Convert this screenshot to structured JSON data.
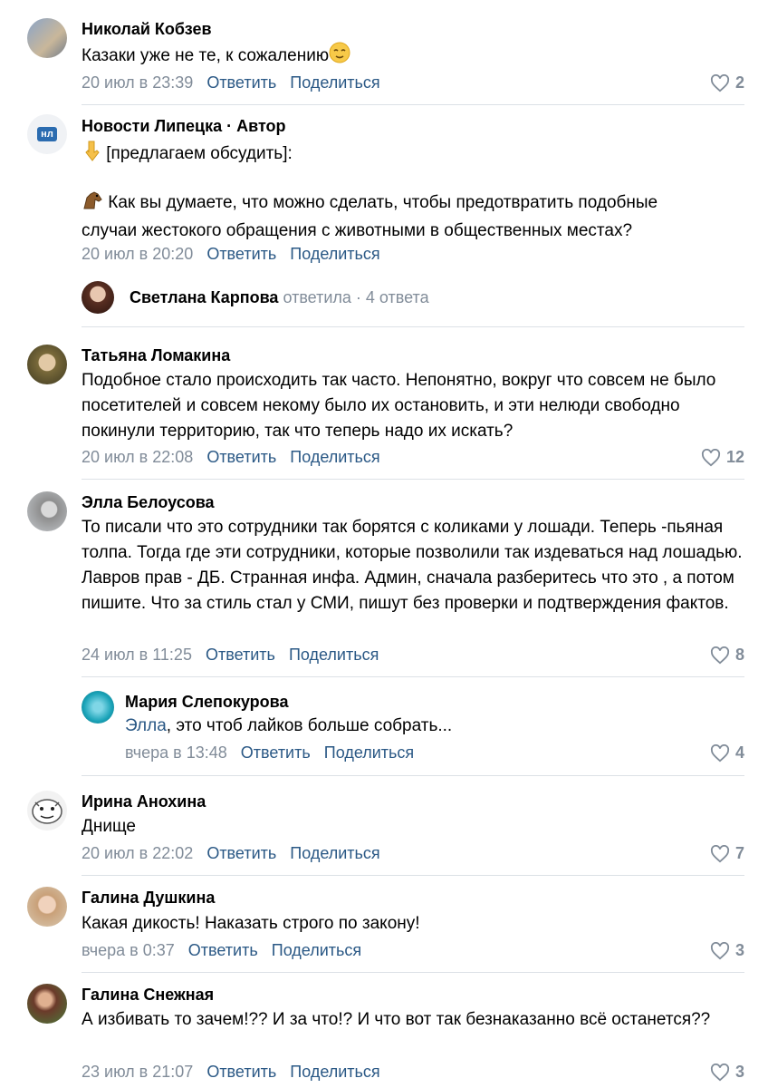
{
  "comments": [
    {
      "name": "Николай Кобзев",
      "text": "Казаки уже не те, к сожалению",
      "date": "20 июл в 23:39",
      "reply": "Ответить",
      "share": "Поделиться",
      "likes": "2"
    },
    {
      "name": "Новости Липецка · Автор",
      "avatar_text": "НЛ",
      "text_line1": "[предлагаем обсудить]:",
      "text_line2": "Как вы думаете, что можно сделать, чтобы предотвратить подобные случаи жестокого обращения с животными в общественных местах?",
      "date": "20 июл в 20:20",
      "reply": "Ответить",
      "share": "Поделиться",
      "replies_summary": {
        "name": "Светлана Карпова",
        "action": "ответила",
        "count": "4 ответа"
      }
    },
    {
      "name": "Татьяна Ломакина",
      "text": "Подобное стало происходить так часто. Непонятно, вокруг что совсем не было посетителей и совсем некому было их остановить, и эти нелюди свободно покинули территорию, так что теперь надо их искать?",
      "date": "20 июл в 22:08",
      "reply": "Ответить",
      "share": "Поделиться",
      "likes": "12"
    },
    {
      "name": "Элла Белоусова",
      "text": "То писали что это сотрудники так борятся с коликами у лошади. Теперь -пьяная толпа. Тогда где эти сотрудники, которые позволили так издеваться над лошадью. Лавров прав - ДБ. Странная инфа. Админ, сначала разберитесь что это , а потом пишите. Что за стиль стал у СМИ, пишут без проверки и подтверждения фактов.",
      "date": "24 июл в 11:25",
      "reply": "Ответить",
      "share": "Поделиться",
      "likes": "8"
    },
    {
      "name": "Мария Слепокурова",
      "mention": "Элла",
      "text": ", это чтоб лайков больше собрать...",
      "date": "вчера в 13:48",
      "reply": "Ответить",
      "share": "Поделиться",
      "likes": "4"
    },
    {
      "name": "Ирина Анохина",
      "text": "Днище",
      "date": "20 июл в 22:02",
      "reply": "Ответить",
      "share": "Поделиться",
      "likes": "7"
    },
    {
      "name": "Галина Душкина",
      "text": "Какая дикость! Наказать строго по закону!",
      "date": "вчера в 0:37",
      "reply": "Ответить",
      "share": "Поделиться",
      "likes": "3"
    },
    {
      "name": "Галина Снежная",
      "text": "А избивать то зачем!?? И за что!? И что вот так безнаказанно всё останется??",
      "date": "23 июл в 21:07",
      "reply": "Ответить",
      "share": "Поделиться",
      "likes": "3"
    }
  ],
  "icons": {
    "like": "heart-outline-icon",
    "emoji_smile": "relieved-face-emoji",
    "emoji_point": "pointing-down-emoji",
    "emoji_horse": "horse-emoji"
  },
  "colors": {
    "link": "#2a5885",
    "meta": "#818c99",
    "separator": "#dce1e6"
  }
}
